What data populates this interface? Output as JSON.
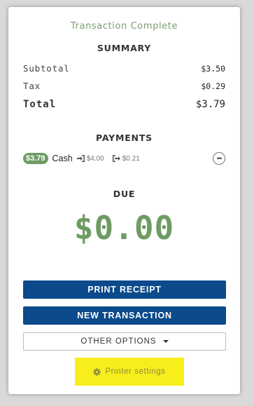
{
  "title": "Transaction Complete",
  "summary": {
    "heading": "SUMMARY",
    "subtotal_label": "Subtotal",
    "subtotal_value": "$3.50",
    "tax_label": "Tax",
    "tax_value": "$0.29",
    "total_label": "Total",
    "total_value": "$3.79"
  },
  "payments": {
    "heading": "PAYMENTS",
    "items": [
      {
        "amount": "$3.79",
        "method": "Cash",
        "tendered": "$4.00",
        "change": "$0.21",
        "tendered_icon": "sign-in-icon",
        "change_icon": "sign-out-icon"
      }
    ],
    "more_label": "•••"
  },
  "due": {
    "heading": "DUE",
    "amount": "$0.00"
  },
  "buttons": {
    "print_receipt": "PRINT RECEIPT",
    "new_transaction": "NEW TRANSACTION",
    "other_options": "OTHER OPTIONS"
  },
  "printer_settings": {
    "label": "Printer settings",
    "icon": "gear-icon",
    "highlight_color": "#f7ee1b"
  },
  "colors": {
    "accent_green": "#6e9b63",
    "primary_blue": "#0b4a8b"
  }
}
